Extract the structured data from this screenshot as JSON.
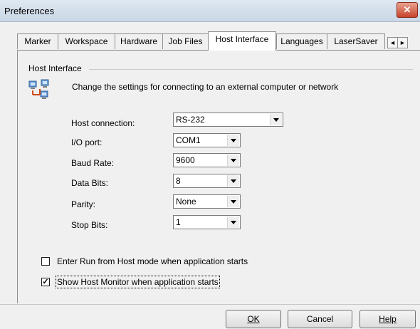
{
  "window": {
    "title": "Preferences",
    "close_glyph": "✕"
  },
  "tabs": [
    {
      "label": "Marker"
    },
    {
      "label": "Workspace"
    },
    {
      "label": "Hardware"
    },
    {
      "label": "Job Files"
    },
    {
      "label": "Host Interface",
      "active": true
    },
    {
      "label": "Languages"
    },
    {
      "label": "LaserSaver"
    }
  ],
  "tab_scroll": {
    "left_icon": "◄",
    "right_icon": "►"
  },
  "group": {
    "label": "Host Interface",
    "icon": "network-computers-icon",
    "description": "Change the settings for connecting to an external computer or network"
  },
  "fields": [
    {
      "label": "Host connection:",
      "value": "RS-232"
    },
    {
      "label": "I/O port:",
      "value": "COM1"
    },
    {
      "label": "Baud Rate:",
      "value": "9600"
    },
    {
      "label": "Data Bits:",
      "value": "8"
    },
    {
      "label": "Parity:",
      "value": "None"
    },
    {
      "label": "Stop Bits:",
      "value": "1"
    }
  ],
  "checkboxes": [
    {
      "label": "Enter Run from Host mode when application starts",
      "checked": false
    },
    {
      "label": "Show Host Monitor when application starts",
      "checked": true
    }
  ],
  "buttons": {
    "ok": "OK",
    "cancel": "Cancel",
    "help": "Help"
  }
}
